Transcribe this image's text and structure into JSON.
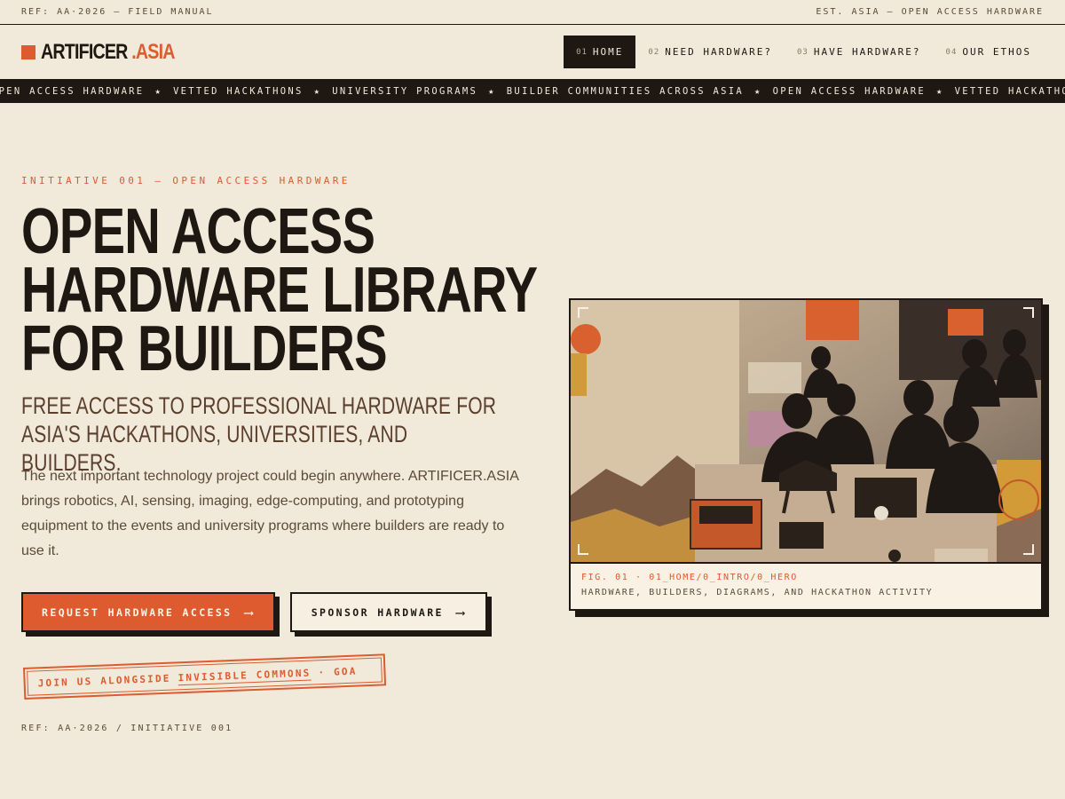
{
  "topstrip": {
    "left": "REF: AA·2026 — FIELD MANUAL",
    "right": "EST. ASIA — OPEN ACCESS HARDWARE"
  },
  "brand": {
    "name": "ARTIFICER",
    "suffix": ".ASIA",
    "accent_color": "#dd5b2e",
    "ink_color": "#1f1712",
    "paper_color": "#f1e9da"
  },
  "nav": {
    "items": [
      {
        "num": "01",
        "label": "HOME",
        "active": true
      },
      {
        "num": "02",
        "label": "NEED HARDWARE?",
        "active": false
      },
      {
        "num": "03",
        "label": "HAVE HARDWARE?",
        "active": false
      },
      {
        "num": "04",
        "label": "OUR ETHOS",
        "active": false
      }
    ]
  },
  "ticker": {
    "items": [
      "OPEN ACCESS HARDWARE",
      "VETTED HACKATHONS",
      "UNIVERSITY PROGRAMS",
      "BUILDER COMMUNITIES ACROSS ASIA",
      "OPEN ACCESS HARDWARE",
      "VETTED HACKATHONS"
    ],
    "separator": "★"
  },
  "hero": {
    "eyebrow": "INITIATIVE 001 — OPEN ACCESS HARDWARE",
    "headline": [
      "OPEN ACCESS",
      "HARDWARE LIBRARY",
      "FOR BUILDERS"
    ],
    "subhead": "FREE ACCESS TO PROFESSIONAL HARDWARE FOR ASIA'S HACKATHONS, UNIVERSITIES, AND BUILDERS.",
    "body": "The next important technology project could begin anywhere. ARTIFICER.ASIA brings robotics, AI, sensing, imaging, edge-computing, and prototyping equipment to the events and university programs where builders are ready to use it.",
    "primary_button": "REQUEST HARDWARE ACCESS",
    "secondary_button": "SPONSOR HARDWARE",
    "arrow_icon": "arrow-right-icon",
    "stamp": {
      "prefix": "JOIN US ALONGSIDE",
      "link": "INVISIBLE COMMONS",
      "suffix": "· GOA"
    },
    "ref": "REF: AA·2026 / INITIATIVE 001"
  },
  "figure": {
    "caption_label": "FIG. 01 · 01_HOME/0_INTRO/0_HERO",
    "caption_text": "HARDWARE, BUILDERS, DIAGRAMS, AND HACKATHON ACTIVITY"
  }
}
